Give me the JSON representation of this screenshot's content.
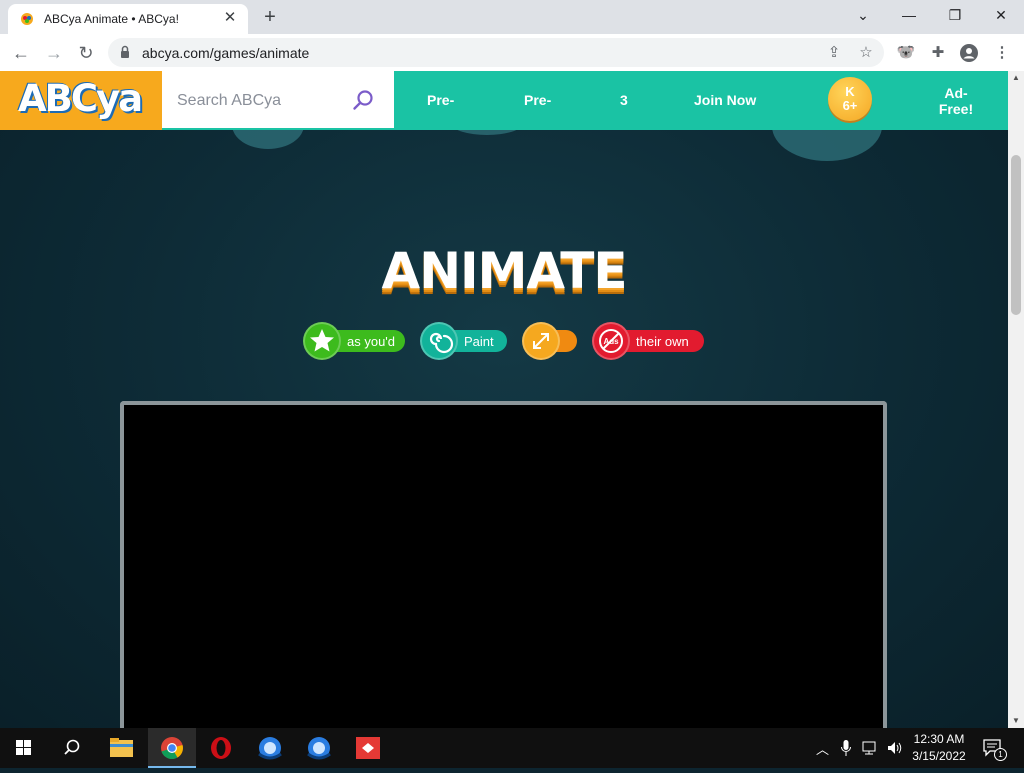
{
  "browser": {
    "tab_title": "ABCya Animate • ABCya!",
    "url": "abcya.com/games/animate"
  },
  "site": {
    "logo": "ABCya",
    "search_placeholder": "Search ABCya",
    "nav": [
      "Pre-",
      "Pre-",
      "3",
      "Join Now"
    ],
    "grade_badge_top": "K",
    "grade_badge_bottom": "6+",
    "ad_free": "Ad-Free!"
  },
  "game": {
    "title": "ANIMATE",
    "features": [
      {
        "label": "as you'd",
        "icon": "star-icon",
        "color": "#3dbb1d"
      },
      {
        "label": "Paint",
        "icon": "swirl-icon",
        "color": "#12b39a"
      },
      {
        "label": "",
        "icon": "fullscreen-icon",
        "color": "#f08a11"
      },
      {
        "label": "their own",
        "icon": "no-ads-icon",
        "color": "#e21b2f"
      }
    ]
  },
  "taskbar": {
    "time": "12:30 AM",
    "date": "3/15/2022",
    "notification_count": "1"
  }
}
